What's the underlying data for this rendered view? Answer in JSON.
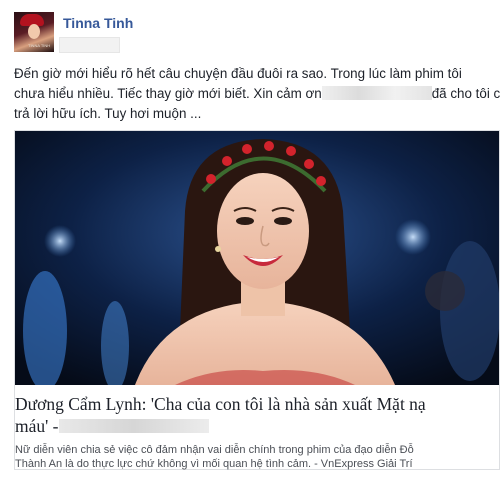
{
  "post": {
    "author": "Tinna Tinh",
    "avatar_label": "TINNA TINH",
    "text_lines": [
      "Đến giờ mới hiểu rõ hết câu chuyện đầu đuôi ra sao. Trong lúc làm phim tôi",
      "chưa hiểu nhiều. Tiếc thay giờ mới biết. Xin cảm ơn",
      "đã cho tôi câu",
      "trả lời hữu ích. Tuy hơi muộn ..."
    ]
  },
  "link_card": {
    "title_line1": "Dương Cẩm Lynh: 'Cha của con tôi là nhà sản xuất Mặt nạ",
    "title_line2": "máu' -",
    "description_lines": [
      "Nữ diễn viên chia sẻ việc cô đảm nhận vai diễn chính trong phim của đạo diễn Đỗ",
      "Thành An là do thực lực chứ không vì mối quan hệ tình cảm. - VnExpress Giải Trí"
    ]
  },
  "colors": {
    "author": "#365899",
    "text": "#1d2129",
    "muted": "#4b4f56",
    "border": "#dddfe2"
  }
}
